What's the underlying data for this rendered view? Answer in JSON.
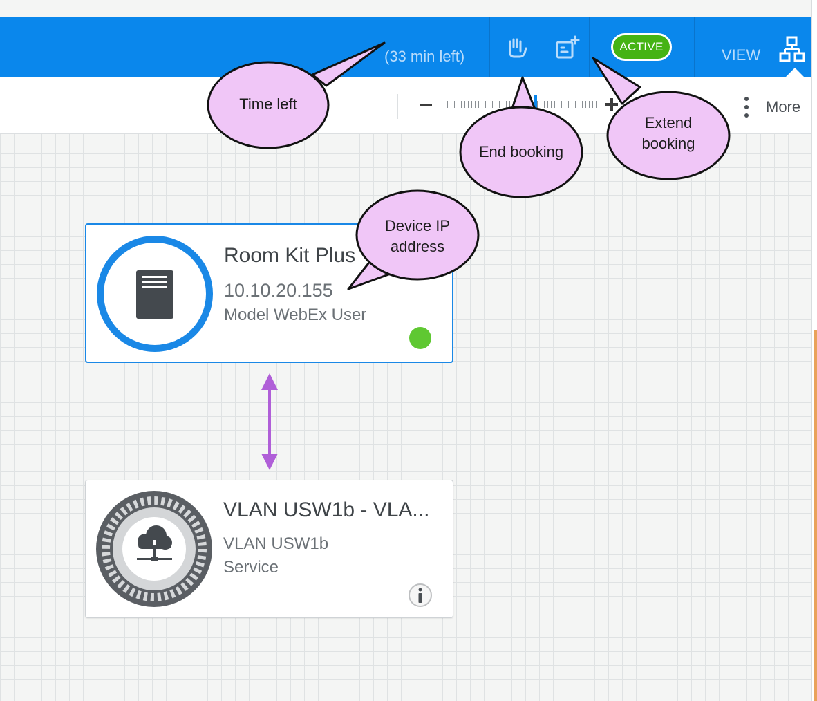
{
  "header": {
    "time_left": "(33 min left)",
    "status_badge": "ACTIVE",
    "view_label": "VIEW",
    "icons": {
      "end_booking": "hand-stop-icon",
      "extend_booking": "calendar-plus-icon",
      "view": "topology-view-icon"
    }
  },
  "toolbar": {
    "more_label": "More",
    "zoom": {
      "minus_icon": "zoom-out-icon",
      "plus_icon": "zoom-in-icon",
      "level": 0.6
    }
  },
  "devices": [
    {
      "name": "Room Kit Plus",
      "ip": "10.10.20.155",
      "model": "Model WebEx User",
      "status": "online",
      "status_color": "#5fc832",
      "icon": "server-device-icon"
    },
    {
      "name": "VLAN USW1b - VLA...",
      "subtitle": "VLAN USW1b",
      "type": "Service",
      "icon": "cloud-network-gear-icon",
      "action_icon": "info-icon"
    }
  ],
  "callouts": [
    {
      "id": "time-left",
      "text": "Time left"
    },
    {
      "id": "end-booking",
      "text": "End booking"
    },
    {
      "id": "extend-booking",
      "lines": [
        "Extend",
        "booking"
      ]
    },
    {
      "id": "device-ip",
      "lines": [
        "Device IP",
        "address"
      ]
    }
  ],
  "colors": {
    "header_blue": "#0a87ec",
    "active_green": "#45b314",
    "callout_fill": "#f0c6f7",
    "link_purple": "#b05fd8"
  }
}
